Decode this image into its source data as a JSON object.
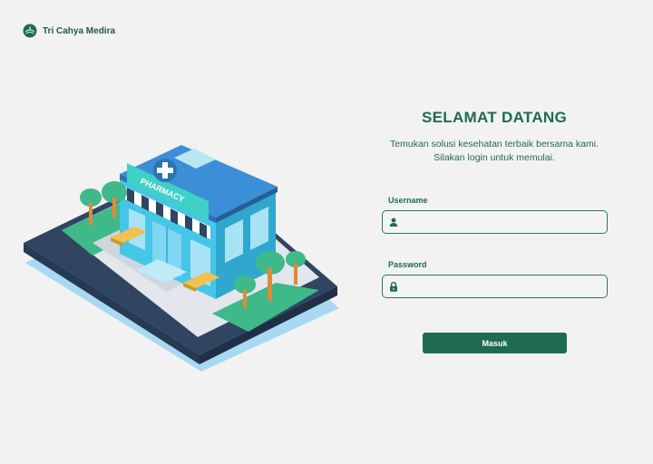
{
  "brand": {
    "name": "Tri Cahya Medira",
    "logo_icon": "globe-leaf-icon"
  },
  "illustration": {
    "sign_text": "PHARMACY"
  },
  "welcome": {
    "title": "SELAMAT DATANG",
    "subtitle_line1": "Temukan solusi kesehatan terbaik bersama kami.",
    "subtitle_line2": "Silakan login untuk memulai."
  },
  "form": {
    "username_label": "Username",
    "username_icon": "user-icon",
    "username_value": "",
    "password_label": "Password",
    "password_icon": "lock-icon",
    "password_value": "",
    "submit_label": "Masuk"
  },
  "colors": {
    "primary": "#1e6b4f",
    "background": "#f2f2f2"
  }
}
